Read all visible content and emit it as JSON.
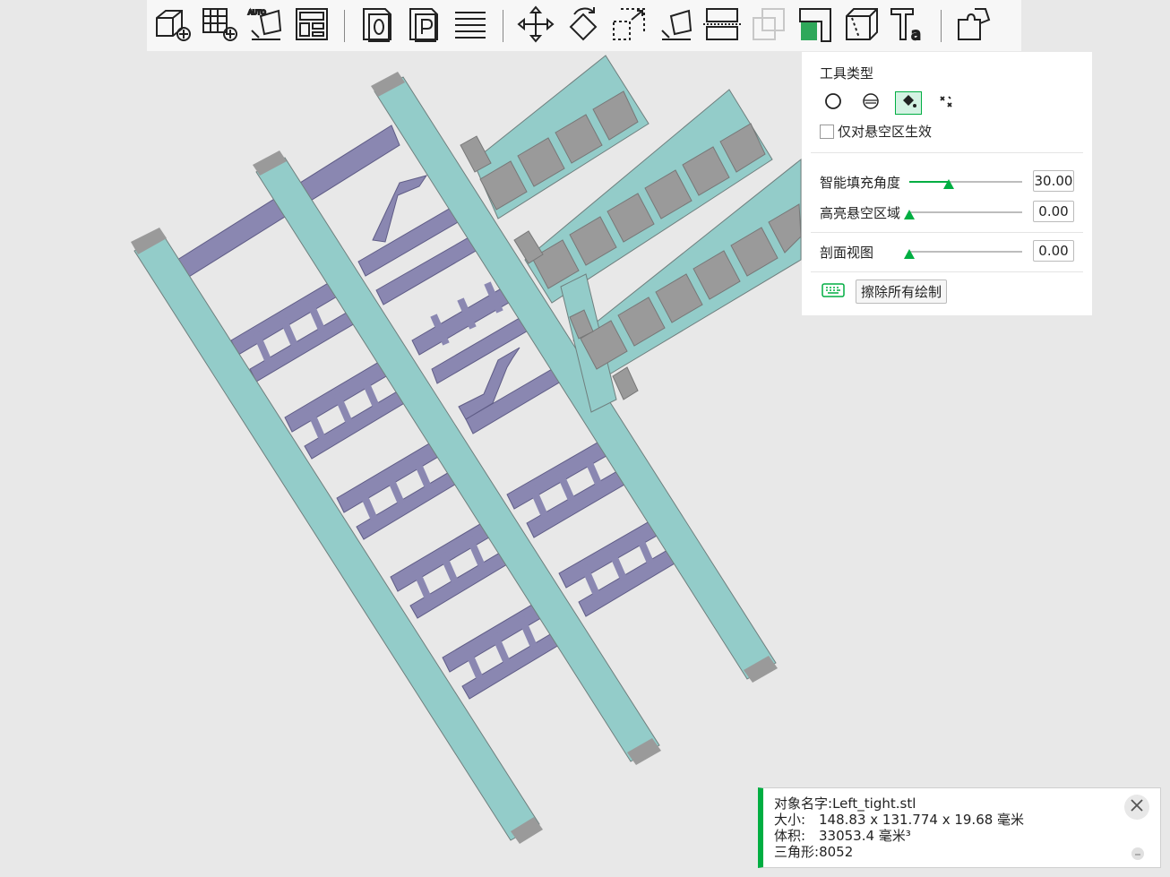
{
  "toolbar": {
    "tools": [
      "add-object-icon",
      "add-plate-icon",
      "auto-orient-icon",
      "arrange-icon",
      "object-list-icon",
      "plate-icon",
      "layers-icon",
      "move-icon",
      "rotate-icon",
      "scale-icon",
      "lay-on-face-icon",
      "cut-icon",
      "boolean-icon",
      "support-paint-icon",
      "seam-icon",
      "text-icon",
      "assembly-icon"
    ],
    "auto_badge": "AUTO"
  },
  "panel": {
    "title": "工具类型",
    "tool_types": [
      "circle-tool-icon",
      "sphere-tool-icon",
      "fill-tool-icon",
      "gap-fill-tool-icon"
    ],
    "active_tool": 2,
    "overhang_only_label": "仅对悬空区生效",
    "overhang_only_checked": false,
    "sliders": [
      {
        "label": "智能填充角度",
        "value": "30.00",
        "fraction": 0.35
      },
      {
        "label": "高亮悬空区域",
        "value": "0.00",
        "fraction": 0.0
      },
      {
        "label": "剖面视图",
        "value": "0.00",
        "fraction": 0.0
      }
    ],
    "erase_label": "擦除所有绘制",
    "accent": "#00ae42"
  },
  "info": {
    "name_label": "对象名字:",
    "name_value": "Left_tight.stl",
    "size_label": "大小:",
    "size_value": "148.83 x 131.774 x 19.68 毫米",
    "volume_label": "体积:",
    "volume_value": "33053.4 毫米³",
    "triangles_label": "三角形:",
    "triangles_value": "8052"
  },
  "model": {
    "rail_color": "#93ccc9",
    "rung_color": "#8a87b1",
    "block_color": "#9a9a9a",
    "background": "#e8e8e8"
  }
}
